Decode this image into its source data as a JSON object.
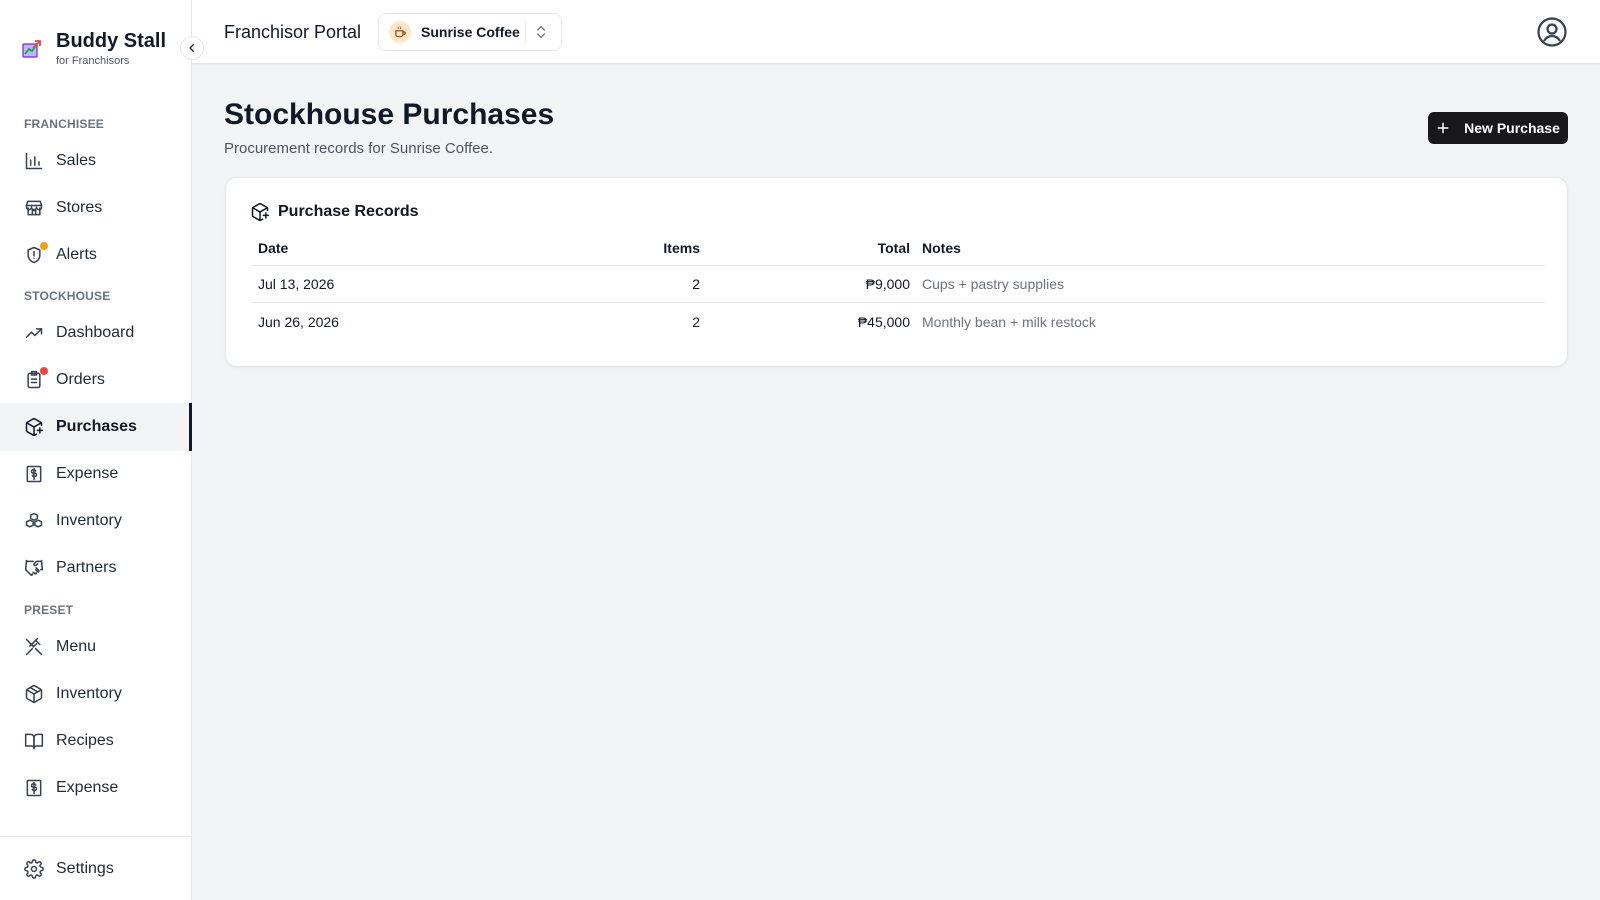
{
  "brand": {
    "name": "Buddy Stall",
    "subtitle": "for Franchisors"
  },
  "topbar": {
    "title": "Franchisor Portal",
    "brand_select": "Sunrise Coffee"
  },
  "sidebar": {
    "sections": {
      "franchisee": "FRANCHISEE",
      "stockhouse": "STOCKHOUSE",
      "preset": "PRESET"
    },
    "items": [
      {
        "label": "Sales",
        "icon": "bar-chart-icon"
      },
      {
        "label": "Stores",
        "icon": "store-icon"
      },
      {
        "label": "Alerts",
        "icon": "alert-shield-icon",
        "badge_color": "#f59e0b"
      },
      {
        "label": "Dashboard",
        "icon": "trending-up-icon"
      },
      {
        "label": "Orders",
        "icon": "clipboard-list-icon",
        "badge_color": "#ef4444"
      },
      {
        "label": "Purchases",
        "icon": "package-plus-icon",
        "active": true
      },
      {
        "label": "Expense",
        "icon": "receipt-dollar-icon"
      },
      {
        "label": "Inventory",
        "icon": "boxes-icon"
      },
      {
        "label": "Partners",
        "icon": "handshake-icon"
      },
      {
        "label": "Menu",
        "icon": "utensils-crossed-icon"
      },
      {
        "label": "Inventory",
        "icon": "package-icon"
      },
      {
        "label": "Recipes",
        "icon": "book-open-icon"
      },
      {
        "label": "Expense",
        "icon": "receipt-dollar-icon"
      },
      {
        "label": "Settings",
        "icon": "gear-icon"
      }
    ]
  },
  "main": {
    "title": "Stockhouse Purchases",
    "subtitle": "Procurement records for Sunrise Coffee.",
    "new_button": "New Purchase",
    "card_title": "Purchase Records",
    "columns": {
      "date": "Date",
      "items": "Items",
      "total": "Total",
      "notes": "Notes"
    },
    "rows": [
      {
        "date": "Jul 13, 2026",
        "items": "2",
        "total": "₱9,000",
        "notes": "Cups + pastry supplies"
      },
      {
        "date": "Jun 26, 2026",
        "items": "2",
        "total": "₱45,000",
        "notes": "Monthly bean + milk restock"
      }
    ]
  }
}
